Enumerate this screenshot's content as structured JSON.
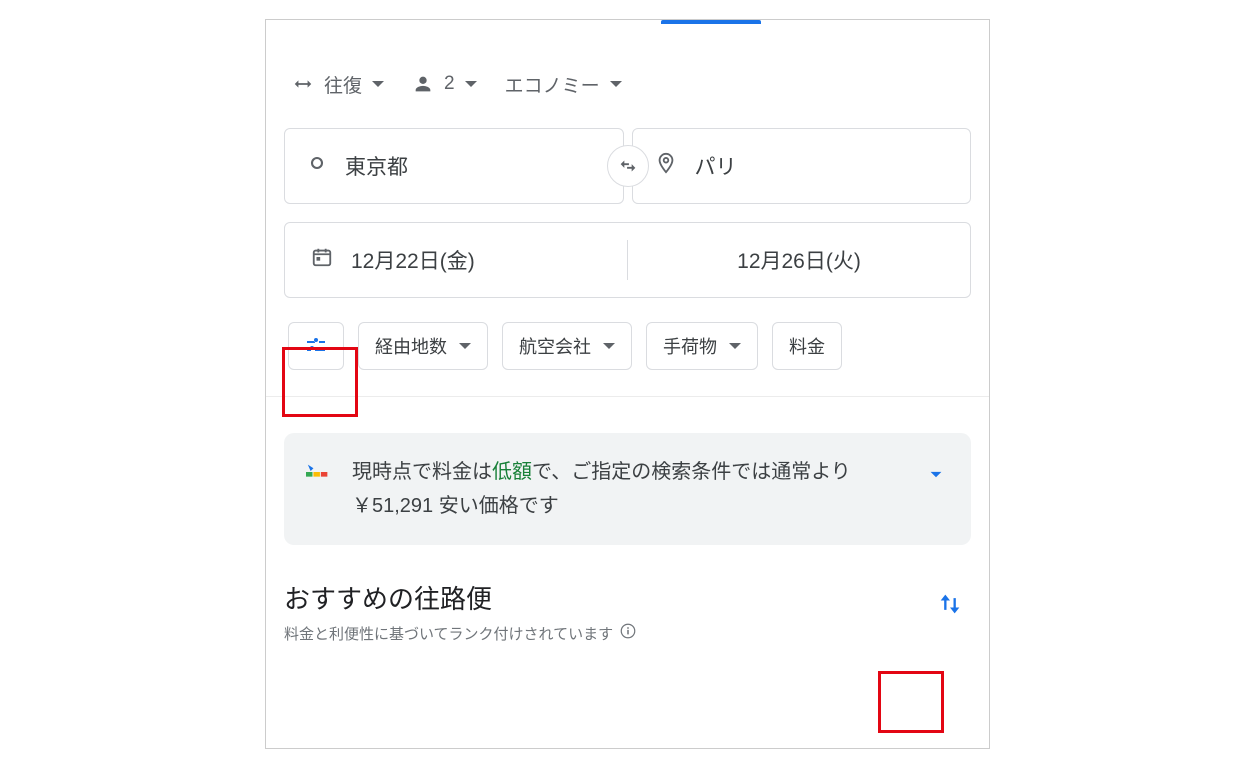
{
  "trip": {
    "type": "往復",
    "passengers": "2",
    "cabin": "エコノミー"
  },
  "origin": "東京都",
  "destination": "パリ",
  "dates": {
    "depart": "12月22日(金)",
    "return": "12月26日(火)"
  },
  "filters": {
    "stops": "経由地数",
    "airlines": "航空会社",
    "bags": "手荷物",
    "price": "料金"
  },
  "price_insight": {
    "prefix": "現時点で料金は",
    "status": "低額",
    "mid": "で、ご指定の検索条件では通常より",
    "amount": "￥51,291",
    "suffix": "安い価格です"
  },
  "recommended": {
    "title": "おすすめの往路便",
    "subtitle": "料金と利便性に基づいてランク付けされています"
  },
  "colors": {
    "accent": "#1a73e8",
    "green": "#188038"
  }
}
